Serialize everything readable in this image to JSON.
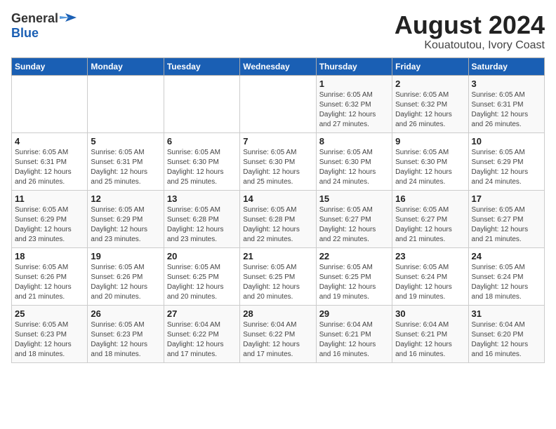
{
  "header": {
    "logo_line1": "General",
    "logo_line2": "Blue",
    "title": "August 2024",
    "subtitle": "Kouatoutou, Ivory Coast"
  },
  "weekdays": [
    "Sunday",
    "Monday",
    "Tuesday",
    "Wednesday",
    "Thursday",
    "Friday",
    "Saturday"
  ],
  "weeks": [
    [
      {
        "day": "",
        "info": ""
      },
      {
        "day": "",
        "info": ""
      },
      {
        "day": "",
        "info": ""
      },
      {
        "day": "",
        "info": ""
      },
      {
        "day": "1",
        "info": "Sunrise: 6:05 AM\nSunset: 6:32 PM\nDaylight: 12 hours\nand 27 minutes."
      },
      {
        "day": "2",
        "info": "Sunrise: 6:05 AM\nSunset: 6:32 PM\nDaylight: 12 hours\nand 26 minutes."
      },
      {
        "day": "3",
        "info": "Sunrise: 6:05 AM\nSunset: 6:31 PM\nDaylight: 12 hours\nand 26 minutes."
      }
    ],
    [
      {
        "day": "4",
        "info": "Sunrise: 6:05 AM\nSunset: 6:31 PM\nDaylight: 12 hours\nand 26 minutes."
      },
      {
        "day": "5",
        "info": "Sunrise: 6:05 AM\nSunset: 6:31 PM\nDaylight: 12 hours\nand 25 minutes."
      },
      {
        "day": "6",
        "info": "Sunrise: 6:05 AM\nSunset: 6:30 PM\nDaylight: 12 hours\nand 25 minutes."
      },
      {
        "day": "7",
        "info": "Sunrise: 6:05 AM\nSunset: 6:30 PM\nDaylight: 12 hours\nand 25 minutes."
      },
      {
        "day": "8",
        "info": "Sunrise: 6:05 AM\nSunset: 6:30 PM\nDaylight: 12 hours\nand 24 minutes."
      },
      {
        "day": "9",
        "info": "Sunrise: 6:05 AM\nSunset: 6:30 PM\nDaylight: 12 hours\nand 24 minutes."
      },
      {
        "day": "10",
        "info": "Sunrise: 6:05 AM\nSunset: 6:29 PM\nDaylight: 12 hours\nand 24 minutes."
      }
    ],
    [
      {
        "day": "11",
        "info": "Sunrise: 6:05 AM\nSunset: 6:29 PM\nDaylight: 12 hours\nand 23 minutes."
      },
      {
        "day": "12",
        "info": "Sunrise: 6:05 AM\nSunset: 6:29 PM\nDaylight: 12 hours\nand 23 minutes."
      },
      {
        "day": "13",
        "info": "Sunrise: 6:05 AM\nSunset: 6:28 PM\nDaylight: 12 hours\nand 23 minutes."
      },
      {
        "day": "14",
        "info": "Sunrise: 6:05 AM\nSunset: 6:28 PM\nDaylight: 12 hours\nand 22 minutes."
      },
      {
        "day": "15",
        "info": "Sunrise: 6:05 AM\nSunset: 6:27 PM\nDaylight: 12 hours\nand 22 minutes."
      },
      {
        "day": "16",
        "info": "Sunrise: 6:05 AM\nSunset: 6:27 PM\nDaylight: 12 hours\nand 21 minutes."
      },
      {
        "day": "17",
        "info": "Sunrise: 6:05 AM\nSunset: 6:27 PM\nDaylight: 12 hours\nand 21 minutes."
      }
    ],
    [
      {
        "day": "18",
        "info": "Sunrise: 6:05 AM\nSunset: 6:26 PM\nDaylight: 12 hours\nand 21 minutes."
      },
      {
        "day": "19",
        "info": "Sunrise: 6:05 AM\nSunset: 6:26 PM\nDaylight: 12 hours\nand 20 minutes."
      },
      {
        "day": "20",
        "info": "Sunrise: 6:05 AM\nSunset: 6:25 PM\nDaylight: 12 hours\nand 20 minutes."
      },
      {
        "day": "21",
        "info": "Sunrise: 6:05 AM\nSunset: 6:25 PM\nDaylight: 12 hours\nand 20 minutes."
      },
      {
        "day": "22",
        "info": "Sunrise: 6:05 AM\nSunset: 6:25 PM\nDaylight: 12 hours\nand 19 minutes."
      },
      {
        "day": "23",
        "info": "Sunrise: 6:05 AM\nSunset: 6:24 PM\nDaylight: 12 hours\nand 19 minutes."
      },
      {
        "day": "24",
        "info": "Sunrise: 6:05 AM\nSunset: 6:24 PM\nDaylight: 12 hours\nand 18 minutes."
      }
    ],
    [
      {
        "day": "25",
        "info": "Sunrise: 6:05 AM\nSunset: 6:23 PM\nDaylight: 12 hours\nand 18 minutes."
      },
      {
        "day": "26",
        "info": "Sunrise: 6:05 AM\nSunset: 6:23 PM\nDaylight: 12 hours\nand 18 minutes."
      },
      {
        "day": "27",
        "info": "Sunrise: 6:04 AM\nSunset: 6:22 PM\nDaylight: 12 hours\nand 17 minutes."
      },
      {
        "day": "28",
        "info": "Sunrise: 6:04 AM\nSunset: 6:22 PM\nDaylight: 12 hours\nand 17 minutes."
      },
      {
        "day": "29",
        "info": "Sunrise: 6:04 AM\nSunset: 6:21 PM\nDaylight: 12 hours\nand 16 minutes."
      },
      {
        "day": "30",
        "info": "Sunrise: 6:04 AM\nSunset: 6:21 PM\nDaylight: 12 hours\nand 16 minutes."
      },
      {
        "day": "31",
        "info": "Sunrise: 6:04 AM\nSunset: 6:20 PM\nDaylight: 12 hours\nand 16 minutes."
      }
    ]
  ]
}
